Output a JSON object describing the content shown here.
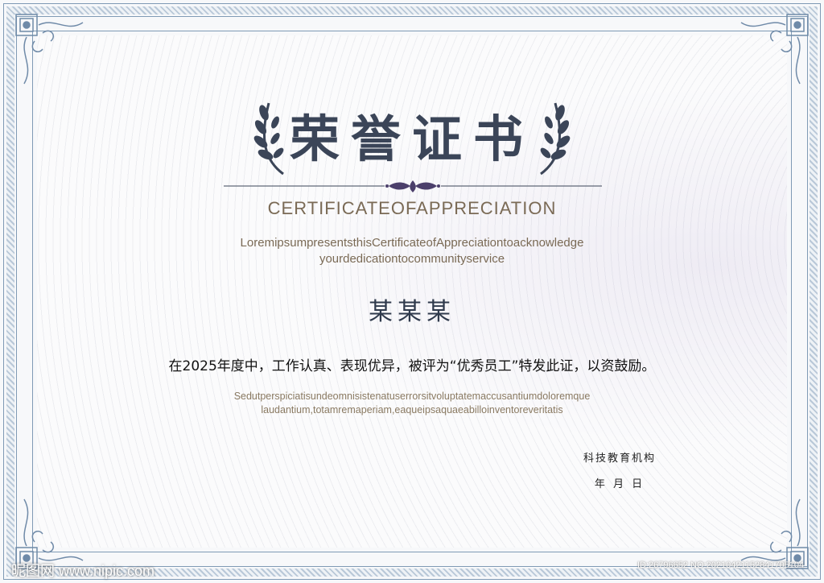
{
  "certificate": {
    "title": "荣誉证书",
    "subtitle": "CERTIFICATEOFAPPRECIATION",
    "intro_line1": "LoremipsumpresentsthisCertificateofAppreciationtoacknowledge",
    "intro_line2": "yourdedicationtocommunityservice",
    "recipient_name": "某某某",
    "body": "在2025年度中，工作认真、表现优异，被评为“优秀员工”特发此证，以资鼓励。",
    "footer_line1": "Sedutperspiciatisundeomnisistenatuserrorsitvoluptatemaccusantiumdoloremque",
    "footer_line2": "laudantium,totamremaperiam,eaqueipsaquaeabilloinventoreveritatis",
    "organization": "科技教育机构",
    "date": "年 月 日"
  },
  "watermark": {
    "left": "昵图网 www.nipic.com",
    "right": "ID:26796652 NO:20210421152841705104"
  },
  "colors": {
    "title": "#3b4558",
    "accent_gold": "#7a6a55",
    "border": "#7f9ab5",
    "laurel": "#3b4558"
  },
  "icons": [
    "laurel-left-icon",
    "laurel-right-icon",
    "flourish-ornament-icon",
    "corner-ornament-icon"
  ]
}
